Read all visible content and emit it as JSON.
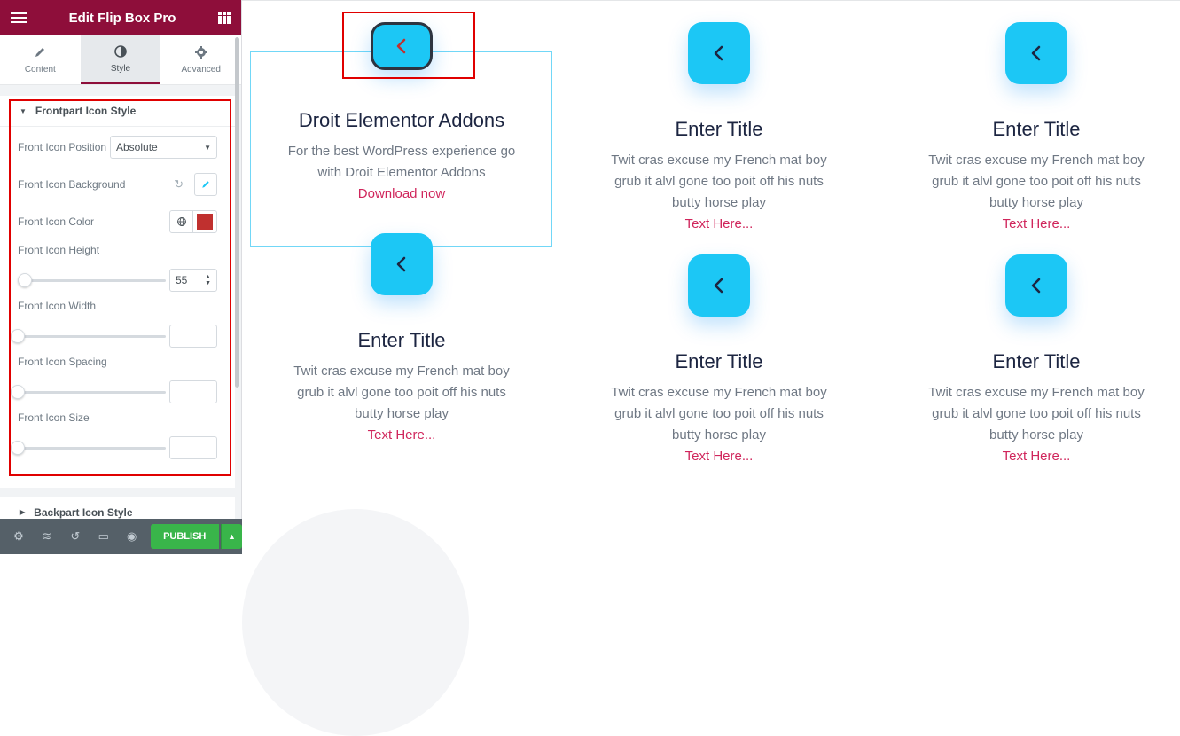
{
  "editor": {
    "title": "Edit Flip Box Pro",
    "tabs": [
      {
        "label": "Content",
        "icon": "pencil-icon"
      },
      {
        "label": "Style",
        "icon": "contrast-icon"
      },
      {
        "label": "Advanced",
        "icon": "gear-icon"
      }
    ],
    "active_tab": "Style",
    "front_section": {
      "title": "Frontpart Icon Style",
      "position_label": "Front Icon Position",
      "position_value": "Absolute",
      "background_label": "Front Icon Background",
      "color_label": "Front Icon Color",
      "color_value": "#c0302f",
      "height_label": "Front Icon Height",
      "height_value": "55",
      "width_label": "Front Icon Width",
      "spacing_label": "Front Icon Spacing",
      "size_label": "Front Icon Size"
    },
    "back_section": {
      "title": "Backpart Icon Style"
    },
    "publish_label": "PUBLISH"
  },
  "canvas": {
    "cards": [
      {
        "title": "Droit Elementor Addons",
        "desc1": "For the best WordPress experience go",
        "desc2": "with Droit Elementor Addons",
        "link": "Download now"
      },
      {
        "title": "Enter Title",
        "desc1": "Twit cras excuse my French mat boy",
        "desc2": "grub it alvl gone too poit off his nuts",
        "desc3": "butty horse play",
        "link": "Text Here..."
      },
      {
        "title": "Enter Title",
        "desc1": "Twit cras excuse my French mat boy",
        "desc2": "grub it alvl gone too poit off his nuts",
        "desc3": "butty horse play",
        "link": "Text Here..."
      },
      {
        "title": "Enter Title",
        "desc1": "Twit cras excuse my French mat boy",
        "desc2": "grub it alvl gone too poit off his nuts",
        "desc3": "butty horse play",
        "link": "Text Here..."
      },
      {
        "title": "Enter Title",
        "desc1": "Twit cras excuse my French mat boy",
        "desc2": "grub it alvl gone too poit off his nuts",
        "desc3": "butty horse play",
        "link": "Text Here..."
      },
      {
        "title": "Enter Title",
        "desc1": "Twit cras excuse my French mat boy",
        "desc2": "grub it alvl gone too poit off his nuts",
        "desc3": "butty horse play",
        "link": "Text Here..."
      }
    ],
    "colors": {
      "icon_bg": "#1cc7f5",
      "active_icon_arrow": "#c0302f",
      "title": "#1c2541",
      "link": "#d0265c"
    }
  }
}
